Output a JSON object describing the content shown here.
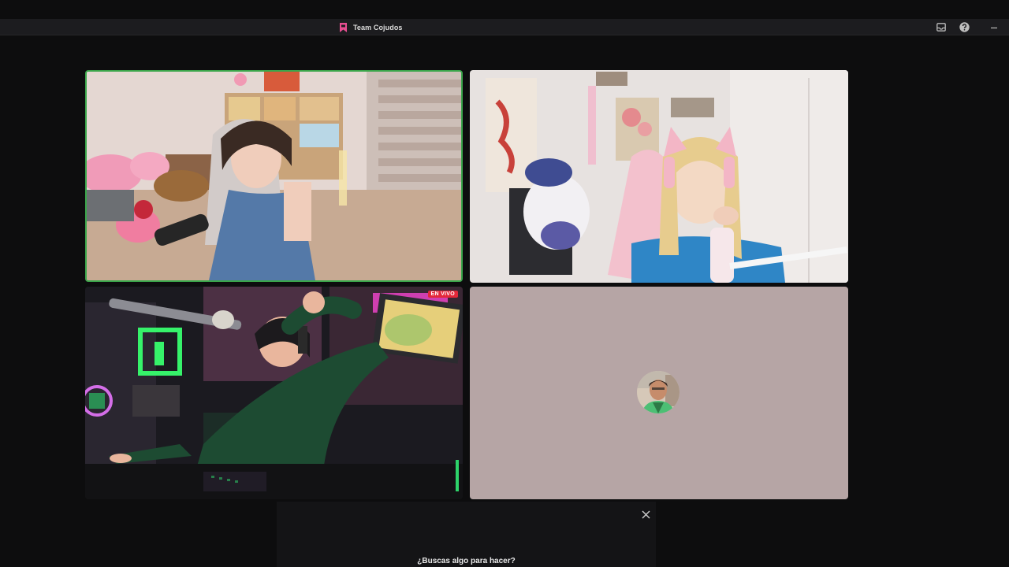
{
  "window": {
    "title": "Team Cojudos",
    "title_icon": "bookmark-icon",
    "controls": [
      "inbox-icon",
      "help-icon",
      "minimize-icon"
    ]
  },
  "call": {
    "tiles": [
      {
        "id": "participant-1",
        "state": "video",
        "speaking": true
      },
      {
        "id": "participant-2",
        "state": "video"
      },
      {
        "id": "participant-3",
        "state": "video",
        "badge": "EN VIVO"
      },
      {
        "id": "participant-4",
        "state": "avatar"
      }
    ]
  },
  "panel": {
    "prompt": "¿Buscas algo para hacer?",
    "close_icon": "close-icon"
  },
  "colors": {
    "speaking_border": "#3aa54a",
    "live_badge": "#e3283a",
    "accent_pink": "#e84e92",
    "avatar_tile_bg": "#b6a5a5"
  }
}
